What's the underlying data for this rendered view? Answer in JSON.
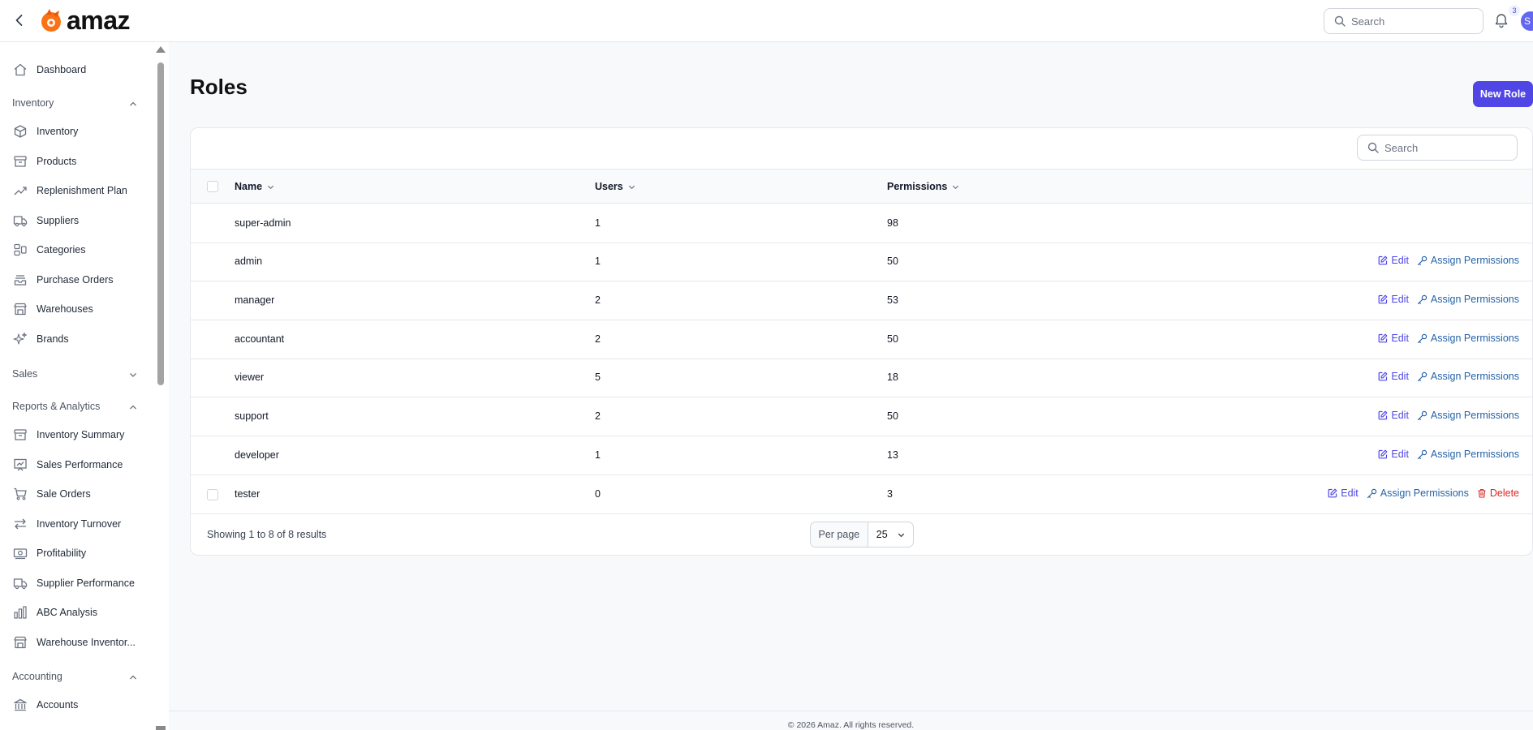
{
  "app": {
    "name": "amaz"
  },
  "topbar": {
    "search_placeholder": "Search",
    "notification_count": "3",
    "avatar_initial": "S"
  },
  "sidebar": {
    "items": [
      {
        "type": "item",
        "label": "Dashboard",
        "icon": "home-icon"
      },
      {
        "type": "group",
        "label": "Inventory",
        "expanded": true
      },
      {
        "type": "item",
        "label": "Inventory",
        "icon": "cube-icon"
      },
      {
        "type": "item",
        "label": "Products",
        "icon": "archive-box-icon"
      },
      {
        "type": "item",
        "label": "Replenishment Plan",
        "icon": "trending-up-icon"
      },
      {
        "type": "item",
        "label": "Suppliers",
        "icon": "truck-icon"
      },
      {
        "type": "item",
        "label": "Categories",
        "icon": "squares-icon"
      },
      {
        "type": "item",
        "label": "Purchase Orders",
        "icon": "inbox-stack-icon"
      },
      {
        "type": "item",
        "label": "Warehouses",
        "icon": "building-storefront-icon"
      },
      {
        "type": "item",
        "label": "Brands",
        "icon": "sparkles-icon"
      },
      {
        "type": "group",
        "label": "Sales",
        "expanded": false
      },
      {
        "type": "group",
        "label": "Reports & Analytics",
        "expanded": true
      },
      {
        "type": "item",
        "label": "Inventory Summary",
        "icon": "archive-box-icon"
      },
      {
        "type": "item",
        "label": "Sales Performance",
        "icon": "chart-presentation-icon"
      },
      {
        "type": "item",
        "label": "Sale Orders",
        "icon": "shopping-cart-icon"
      },
      {
        "type": "item",
        "label": "Inventory Turnover",
        "icon": "arrows-right-left-icon"
      },
      {
        "type": "item",
        "label": "Profitability",
        "icon": "banknotes-icon"
      },
      {
        "type": "item",
        "label": "Supplier Performance",
        "icon": "truck-icon"
      },
      {
        "type": "item",
        "label": "ABC Analysis",
        "icon": "chart-bar-icon"
      },
      {
        "type": "item",
        "label": "Warehouse Inventor...",
        "icon": "building-storefront-icon"
      },
      {
        "type": "group",
        "label": "Accounting",
        "expanded": true
      },
      {
        "type": "item",
        "label": "Accounts",
        "icon": "building-library-icon"
      }
    ]
  },
  "page": {
    "title": "Roles",
    "new_button": "New Role"
  },
  "table": {
    "search_placeholder": "Search",
    "columns": [
      "Name",
      "Users",
      "Permissions"
    ],
    "rows": [
      {
        "name": "super-admin",
        "users": "1",
        "permissions": "98",
        "actions": []
      },
      {
        "name": "admin",
        "users": "1",
        "permissions": "50",
        "actions": [
          "Edit",
          "Assign Permissions"
        ]
      },
      {
        "name": "manager",
        "users": "2",
        "permissions": "53",
        "actions": [
          "Edit",
          "Assign Permissions"
        ]
      },
      {
        "name": "accountant",
        "users": "2",
        "permissions": "50",
        "actions": [
          "Edit",
          "Assign Permissions"
        ]
      },
      {
        "name": "viewer",
        "users": "5",
        "permissions": "18",
        "actions": [
          "Edit",
          "Assign Permissions"
        ]
      },
      {
        "name": "support",
        "users": "2",
        "permissions": "50",
        "actions": [
          "Edit",
          "Assign Permissions"
        ]
      },
      {
        "name": "developer",
        "users": "1",
        "permissions": "13",
        "actions": [
          "Edit",
          "Assign Permissions"
        ]
      },
      {
        "name": "tester",
        "users": "0",
        "permissions": "3",
        "actions": [
          "Edit",
          "Assign Permissions",
          "Delete"
        ],
        "selectable": true
      }
    ],
    "showing": "Showing 1 to 8 of 8 results",
    "per_page_label": "Per page",
    "per_page_value": "25"
  },
  "footer": {
    "copyright": "© 2026 Amaz. All rights reserved."
  },
  "colors": {
    "accent": "#4f46e5",
    "link": "#2563a8",
    "danger": "#dc2626"
  }
}
